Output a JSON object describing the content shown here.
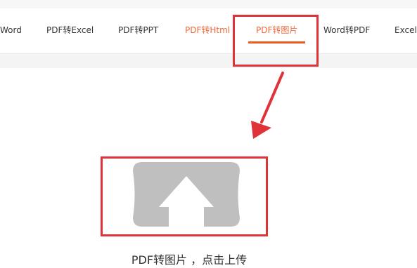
{
  "tabs": [
    {
      "label": "Word"
    },
    {
      "label": "PDF转Excel"
    },
    {
      "label": "PDF转PPT"
    },
    {
      "label": "PDF转Html"
    },
    {
      "label": "PDF转图片"
    },
    {
      "label": "Word转PDF"
    },
    {
      "label": "Excel转"
    }
  ],
  "active_tab": "PDF转图片",
  "upload": {
    "caption": "PDF转图片 ，点击上传"
  },
  "colors": {
    "accent": "#ee6a3c",
    "underline": "#ee5a1e",
    "annotation": "#e03339",
    "upload_icon": "#bfbfbf"
  },
  "icons": {
    "upload": "upload-arrow-icon",
    "annotation_arrow": "red-pointer-arrow"
  }
}
